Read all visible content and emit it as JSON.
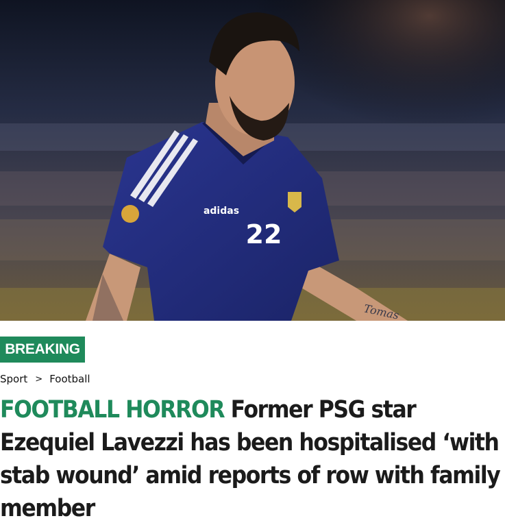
{
  "hero": {
    "jersey_number": "22",
    "jersey_brand": "adidas",
    "tattoo_text": "Tomas"
  },
  "badge": {
    "label": "BREAKING"
  },
  "breadcrumb": {
    "items": [
      "Sport",
      "Football"
    ],
    "separator": ">"
  },
  "headline": {
    "kicker": "FOOTBALL HORROR",
    "text": "Former PSG star Ezequiel Lavezzi has been hospitalised ‘with stab wound’ amid reports of row with family member"
  },
  "colors": {
    "accent": "#1f8a5b",
    "text": "#1b1b1b"
  }
}
